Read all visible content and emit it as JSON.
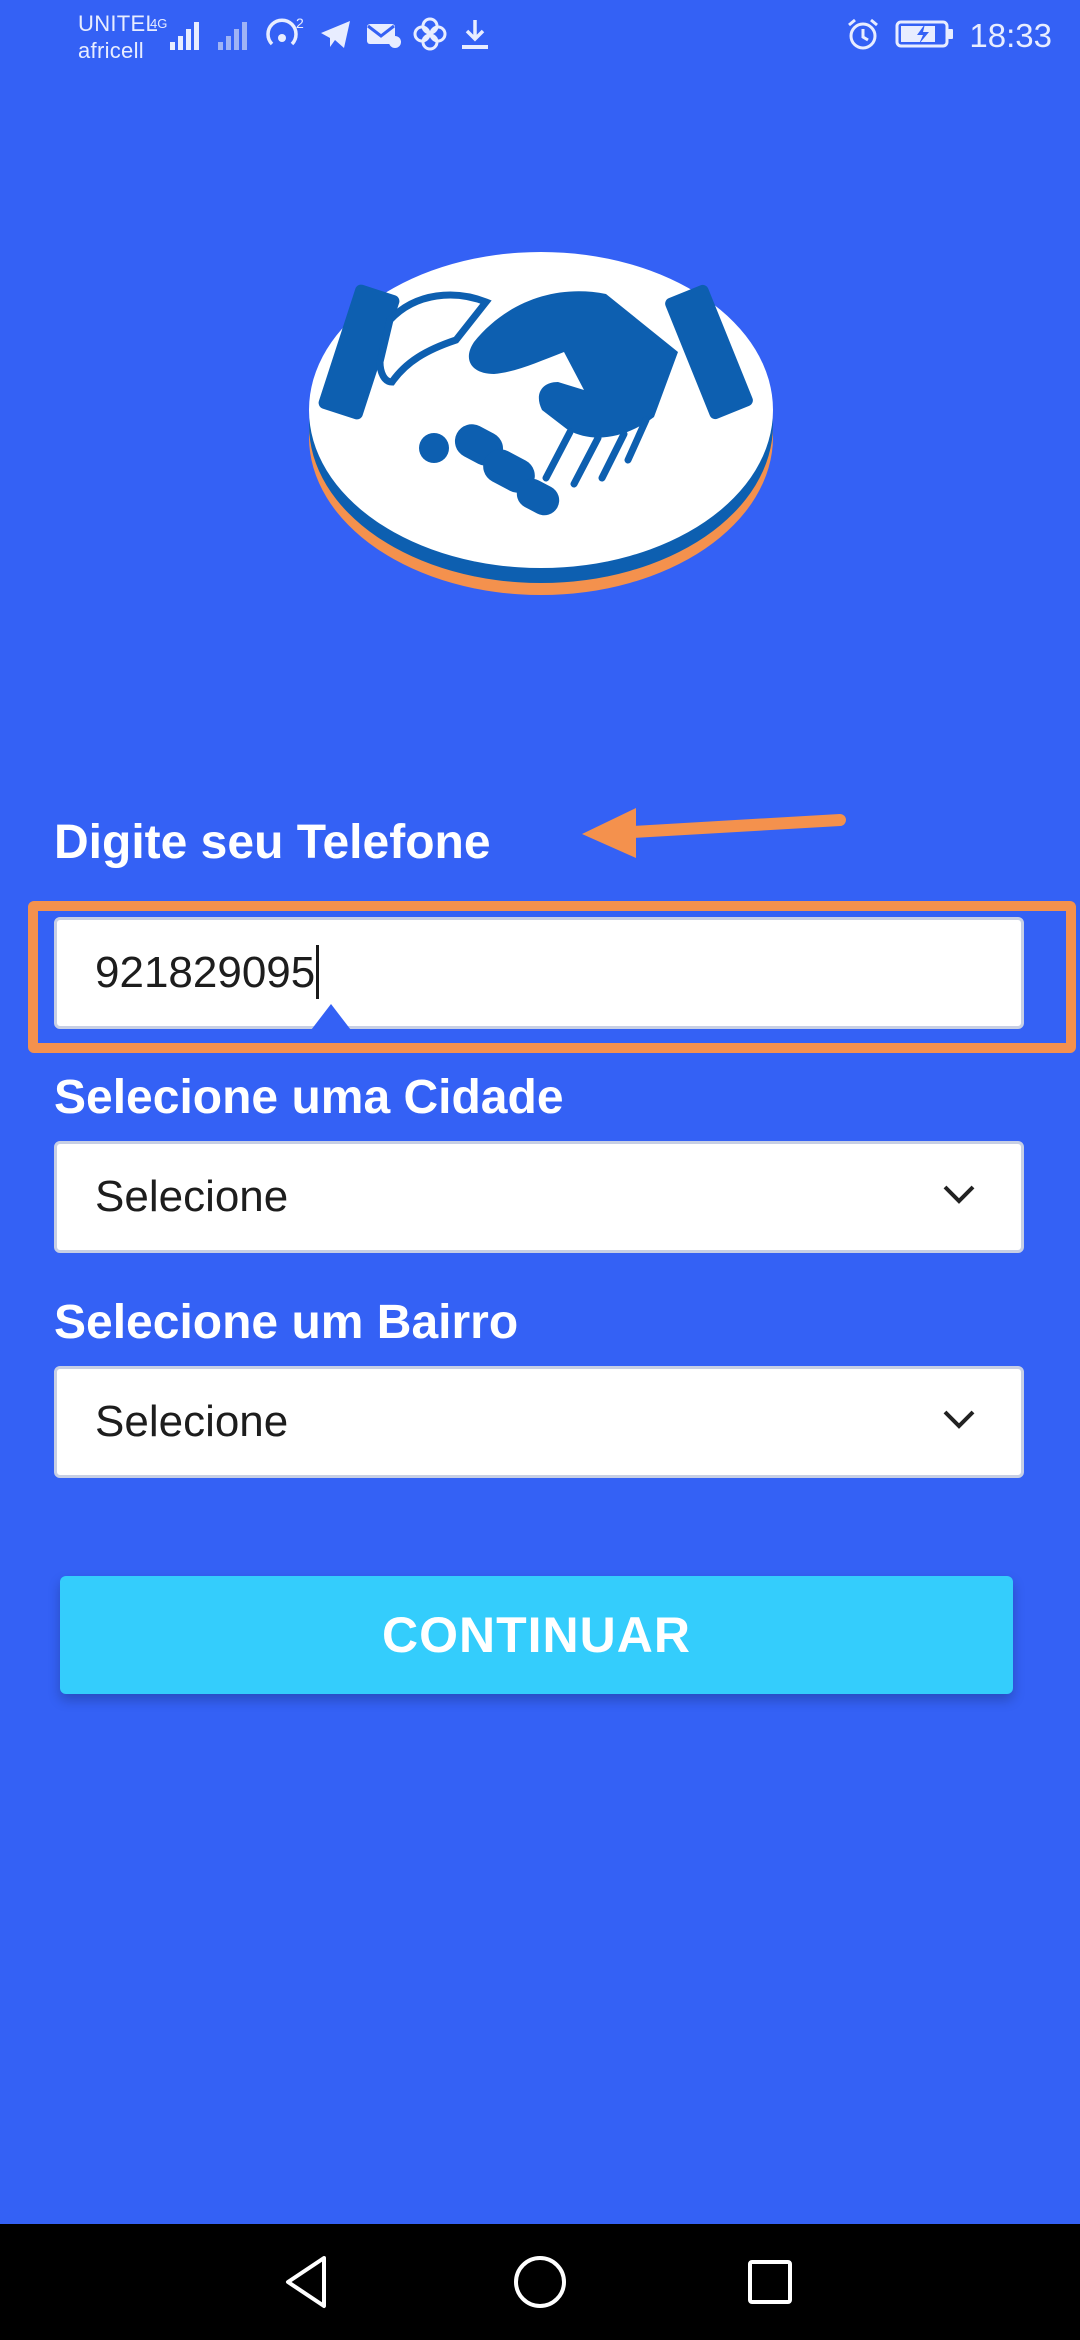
{
  "status_bar": {
    "carrier_1": "UNITEL",
    "carrier_2": "africell",
    "network_type": "4G",
    "sim2_indicator": "2",
    "time": "18:33",
    "icons": [
      "signal-icon",
      "hotspot-icon",
      "telegram-icon",
      "mail-icon",
      "pinwheel-icon",
      "download-icon",
      "alarm-icon",
      "battery-charging-icon"
    ]
  },
  "logo": {
    "icon": "handshake-logo-icon",
    "colors": {
      "primary": "#0d5fb0",
      "accent": "#f4914d",
      "disc": "#ffffff"
    }
  },
  "form": {
    "phone_label": "Digite seu Telefone",
    "phone_value": "921829095",
    "city_label": "Selecione uma Cidade",
    "city_selected": "Selecione",
    "district_label": "Selecione um Bairro",
    "district_selected": "Selecione",
    "continue_label": "CONTINUAR"
  },
  "annotation": {
    "color": "#f4914d",
    "arrow_icon": "arrow-left-icon"
  },
  "colors": {
    "background": "#3461f5",
    "button": "#34cdfc",
    "field": "#ffffff"
  },
  "nav_bar": {
    "icons": [
      "back-triangle-icon",
      "home-circle-icon",
      "recents-square-icon"
    ]
  }
}
